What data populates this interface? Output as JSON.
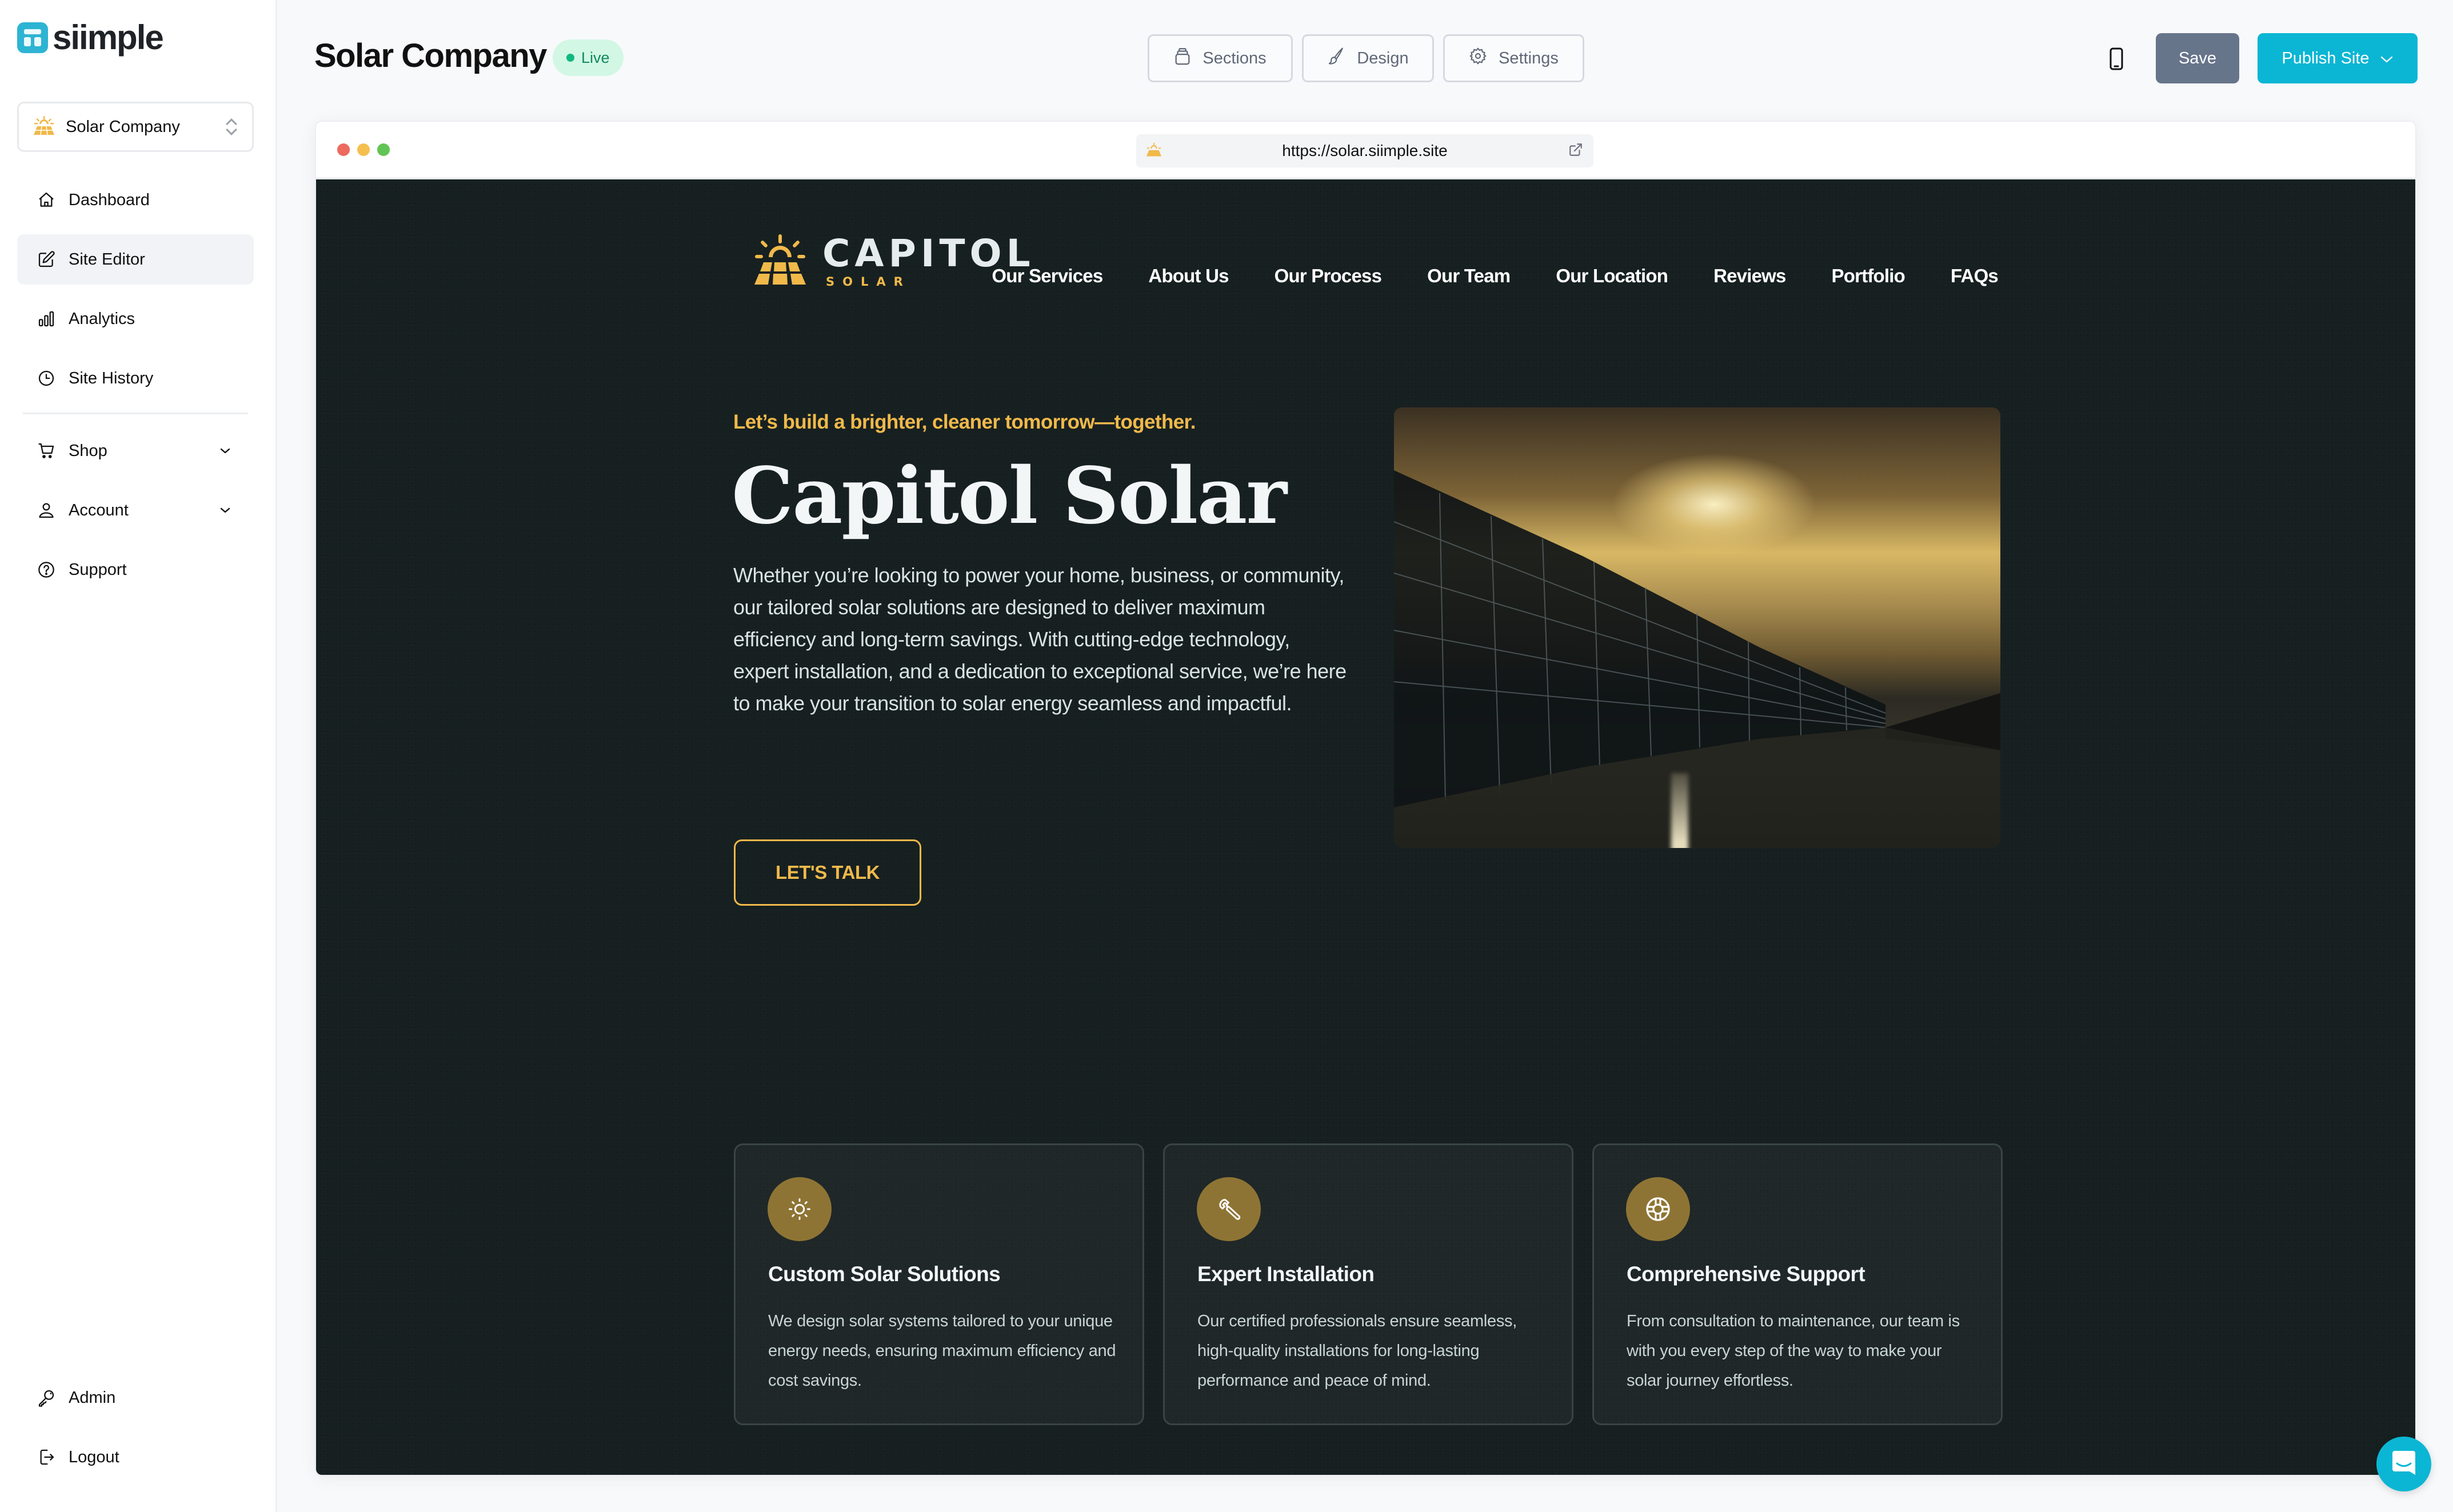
{
  "app": {
    "brand": "siimple",
    "site_switcher": {
      "label": "Solar Company",
      "icon": "solar-panel-icon"
    }
  },
  "sidebar": {
    "items": [
      {
        "label": "Dashboard",
        "icon": "home-icon",
        "active": false
      },
      {
        "label": "Site Editor",
        "icon": "edit-icon",
        "active": true
      },
      {
        "label": "Analytics",
        "icon": "bar-chart-icon",
        "active": false
      },
      {
        "label": "Site History",
        "icon": "clock-icon",
        "active": false
      }
    ],
    "groups": [
      {
        "label": "Shop",
        "icon": "cart-icon",
        "expandable": true
      },
      {
        "label": "Account",
        "icon": "user-icon",
        "expandable": true
      },
      {
        "label": "Support",
        "icon": "help-circle-icon",
        "expandable": false
      }
    ],
    "footer": [
      {
        "label": "Admin",
        "icon": "key-icon"
      },
      {
        "label": "Logout",
        "icon": "logout-icon"
      }
    ]
  },
  "topbar": {
    "title": "Solar Company",
    "status": "Live",
    "tools": [
      {
        "label": "Sections",
        "icon": "layers-icon"
      },
      {
        "label": "Design",
        "icon": "brush-icon"
      },
      {
        "label": "Settings",
        "icon": "gear-icon"
      }
    ],
    "device_toggle": "mobile-icon",
    "save_label": "Save",
    "publish_label": "Publish Site"
  },
  "preview": {
    "url": "https://solar.siimple.site",
    "site": {
      "logo_primary": "CAPITOL",
      "logo_secondary": "SOLAR",
      "menu": [
        "Our Services",
        "About Us",
        "Our Process",
        "Our Team",
        "Our Location",
        "Reviews",
        "Portfolio",
        "FAQs"
      ],
      "hero": {
        "kicker": "Let’s build a brighter, cleaner tomorrow—together.",
        "title": "Capitol Solar",
        "body": "Whether you’re looking to power your home, business, or community, our tailored solar solutions are designed to deliver maximum efficiency and long-term savings. With cutting-edge technology, expert installation, and a dedication to exceptional service, we’re here to make your transition to solar energy seamless and impactful.",
        "cta": "LET'S TALK",
        "image_alt": "Solar panel array beside water at sunset"
      },
      "features": [
        {
          "icon": "sun-icon",
          "title": "Custom Solar Solutions",
          "text": "We design solar systems tailored to your unique energy needs, ensuring maximum efficiency and cost savings."
        },
        {
          "icon": "wrench-icon",
          "title": "Expert Installation",
          "text": "Our certified professionals ensure seamless, high-quality installations for long-lasting performance and peace of mind."
        },
        {
          "icon": "lifebuoy-icon",
          "title": "Comprehensive Support",
          "text": "From consultation to maintenance, our team is with you every step of the way to make your solar journey effortless."
        }
      ]
    }
  },
  "colors": {
    "brand_accent": "#0bb6d4",
    "site_accent": "#f0b94a",
    "site_background": "#172021",
    "live_green": "#10b981",
    "save_gray": "#67758b",
    "feature_icon_bg": "#8e7434"
  },
  "chat_widget": {
    "icon": "chat-icon"
  }
}
